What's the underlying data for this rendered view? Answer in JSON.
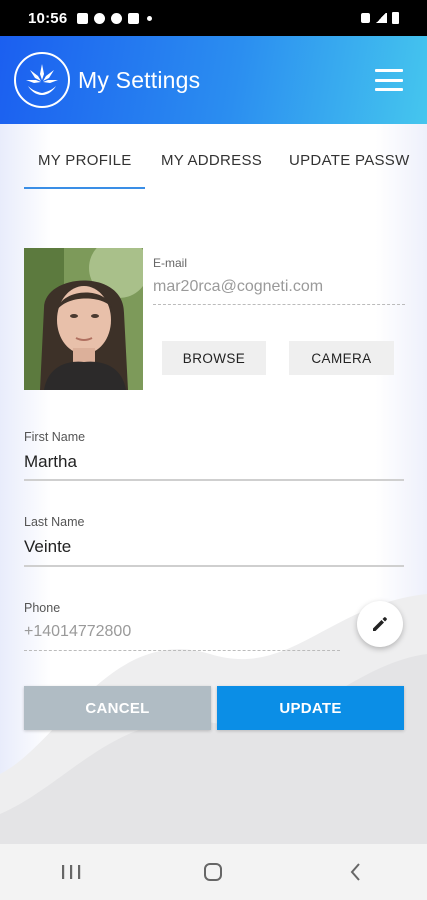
{
  "status_bar": {
    "time": "10:56"
  },
  "header": {
    "title": "My Settings",
    "menu_icon": "hamburger-menu-icon",
    "logo_icon": "leaf-hands-logo"
  },
  "tabs": [
    {
      "label": "MY PROFILE",
      "active": true
    },
    {
      "label": "MY ADDRESS",
      "active": false
    },
    {
      "label": "UPDATE PASSW",
      "active": false
    }
  ],
  "profile": {
    "email_label": "E-mail",
    "email_value": "mar20rca@cogneti.com",
    "browse_label": "BROWSE",
    "camera_label": "CAMERA"
  },
  "form": {
    "first_name_label": "First Name",
    "first_name_value": "Martha",
    "last_name_label": "Last Name",
    "last_name_value": "Veinte",
    "phone_label": "Phone",
    "phone_value": "+14014772800",
    "edit_icon": "pencil-icon"
  },
  "actions": {
    "cancel_label": "CANCEL",
    "update_label": "UPDATE"
  },
  "nav": {
    "recents_icon": "recents-icon",
    "home_icon": "home-icon",
    "back_icon": "back-icon"
  },
  "colors": {
    "header_start": "#1b5ff0",
    "header_end": "#45c6ee",
    "update": "#0b8ee6",
    "cancel": "#b0bcc4",
    "tab_indicator": "#3a8ee6"
  }
}
